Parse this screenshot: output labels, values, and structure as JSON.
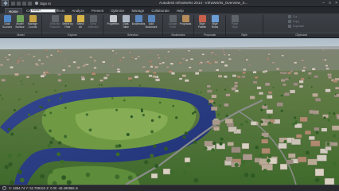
{
  "titlebar": {
    "signin": "Sign In",
    "search_value": "master",
    "title": "Autodesk InfraWorks 2014 - InfraWorks_Overview_S..."
  },
  "tabs": [
    "Home",
    "Create",
    "Visual Effects",
    "Analyze",
    "Present",
    "Optimize",
    "Manage",
    "Collaborate",
    "Help"
  ],
  "active_tab": "Home",
  "ribbon": {
    "buttons": [
      {
        "label": "Data\nSources",
        "color": "#4f86c6",
        "enabled": true
      },
      {
        "label": "Model\nSurface",
        "color": "#6fa35a",
        "enabled": true
      },
      {
        "label": "Manage\nCoords",
        "color": "#c9a545",
        "enabled": true
      },
      {
        "label": "Selected\nFeatures",
        "color": "#8a8f96",
        "enabled": false
      },
      {
        "label": "Select by\nFilter",
        "color": "#d8b448",
        "enabled": true
      },
      {
        "label": "Select\nAll",
        "color": "#d8b448",
        "enabled": true
      },
      {
        "label": "Clear\nSelected",
        "color": "#8a8f96",
        "enabled": false
      },
      {
        "label": "Properties",
        "color": "#c4c8cd",
        "enabled": true
      },
      {
        "label": "Data\nTable",
        "color": "#aeb8c4",
        "enabled": true
      },
      {
        "label": "Bookmarks",
        "color": "#5a86c0",
        "enabled": true
      },
      {
        "label": "Add\nBookmark",
        "color": "#5a86c0",
        "enabled": true
      },
      {
        "label": "Gadget\nFeed",
        "color": "#8a8f96",
        "enabled": false
      },
      {
        "label": "Proposals",
        "color": "#b58c5a",
        "enabled": true
      },
      {
        "label": "Style\nPalette",
        "color": "#c7604c",
        "enabled": true
      },
      {
        "label": "Style\nRules",
        "color": "#6b9ed4",
        "enabled": true
      },
      {
        "label": "Paste\nStyle",
        "color": "#8a8f96",
        "enabled": false
      }
    ],
    "small_buttons": [
      "Cut",
      "Copy",
      "Duplicate"
    ],
    "groups": [
      "Model",
      "Explore",
      "Selection",
      "Bookmarks",
      "Proposals",
      "Style",
      "Clipboard"
    ]
  },
  "status": {
    "coords": "X: 4894.74 Y: 52.789152 Z: 0.00 -48.490955 m"
  },
  "colors": {
    "river": "#2a3f8c",
    "grass": "#4d7d39",
    "ribbon_bg": "#3a3e44"
  }
}
